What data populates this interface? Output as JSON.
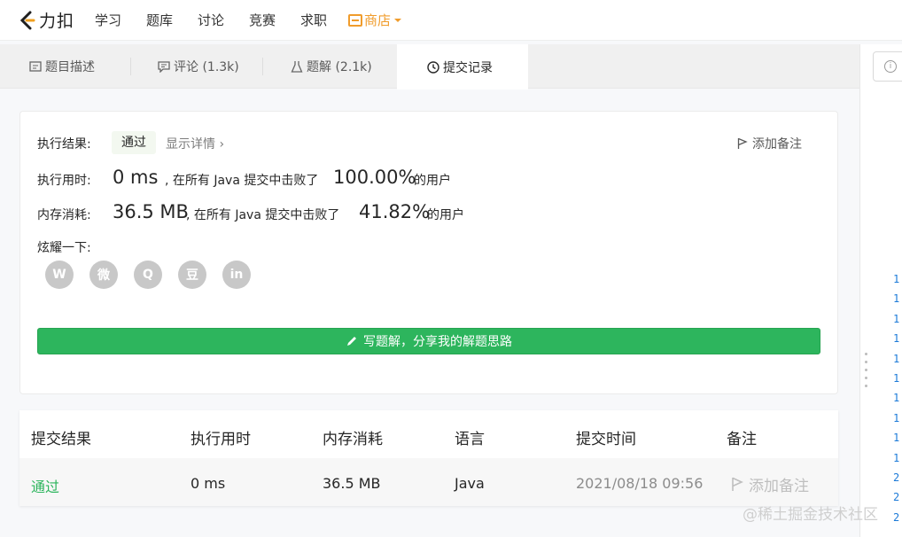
{
  "nav": {
    "logo_text": "力扣",
    "items": [
      "学习",
      "题库",
      "讨论",
      "竞赛",
      "求职"
    ],
    "shop_label": "商店"
  },
  "tabs": [
    {
      "label": "题目描述",
      "icon": "document-icon"
    },
    {
      "label": "评论 (1.3k)",
      "icon": "comment-icon"
    },
    {
      "label": "题解 (2.1k)",
      "icon": "flask-icon"
    },
    {
      "label": "提交记录",
      "icon": "clock-icon",
      "active": true
    }
  ],
  "result": {
    "result_label": "执行结果:",
    "status": "通过",
    "detail_link": "显示详情 ›",
    "add_note": "添加备注",
    "runtime_label": "执行用时:",
    "runtime_value": "0 ms",
    "runtime_mid": ", 在所有 Java 提交中击败了",
    "runtime_percent": "100.00%",
    "runtime_suffix": "的用户",
    "memory_label": "内存消耗:",
    "memory_value": "36.5 MB",
    "memory_mid": ", 在所有 Java 提交中击败了",
    "memory_percent": "41.82%",
    "memory_suffix": "的用户",
    "share_label": "炫耀一下:",
    "share_icons": [
      "wechat-icon",
      "weibo-icon",
      "qq-icon",
      "douban-icon",
      "linkedin-icon"
    ],
    "share_glyphs": [
      "W",
      "微",
      "Q",
      "豆",
      "in"
    ],
    "write_button": "写题解，分享我的解题思路"
  },
  "table": {
    "headers": [
      "提交结果",
      "执行用时",
      "内存消耗",
      "语言",
      "提交时间",
      "备注"
    ],
    "rows": [
      {
        "result": "通过",
        "runtime": "0 ms",
        "memory": "36.5 MB",
        "language": "Java",
        "time": "2021/08/18 09:56",
        "note": "添加备注"
      }
    ]
  },
  "editor": {
    "line_numbers": [
      "1",
      "1",
      "1",
      "1",
      "1",
      "1",
      "1",
      "1",
      "1",
      "1",
      "2",
      "2",
      "2"
    ]
  },
  "watermark": "@稀土掘金技术社区",
  "colors": {
    "accent_green": "#2db55d",
    "shop_orange": "#f09c2c"
  }
}
